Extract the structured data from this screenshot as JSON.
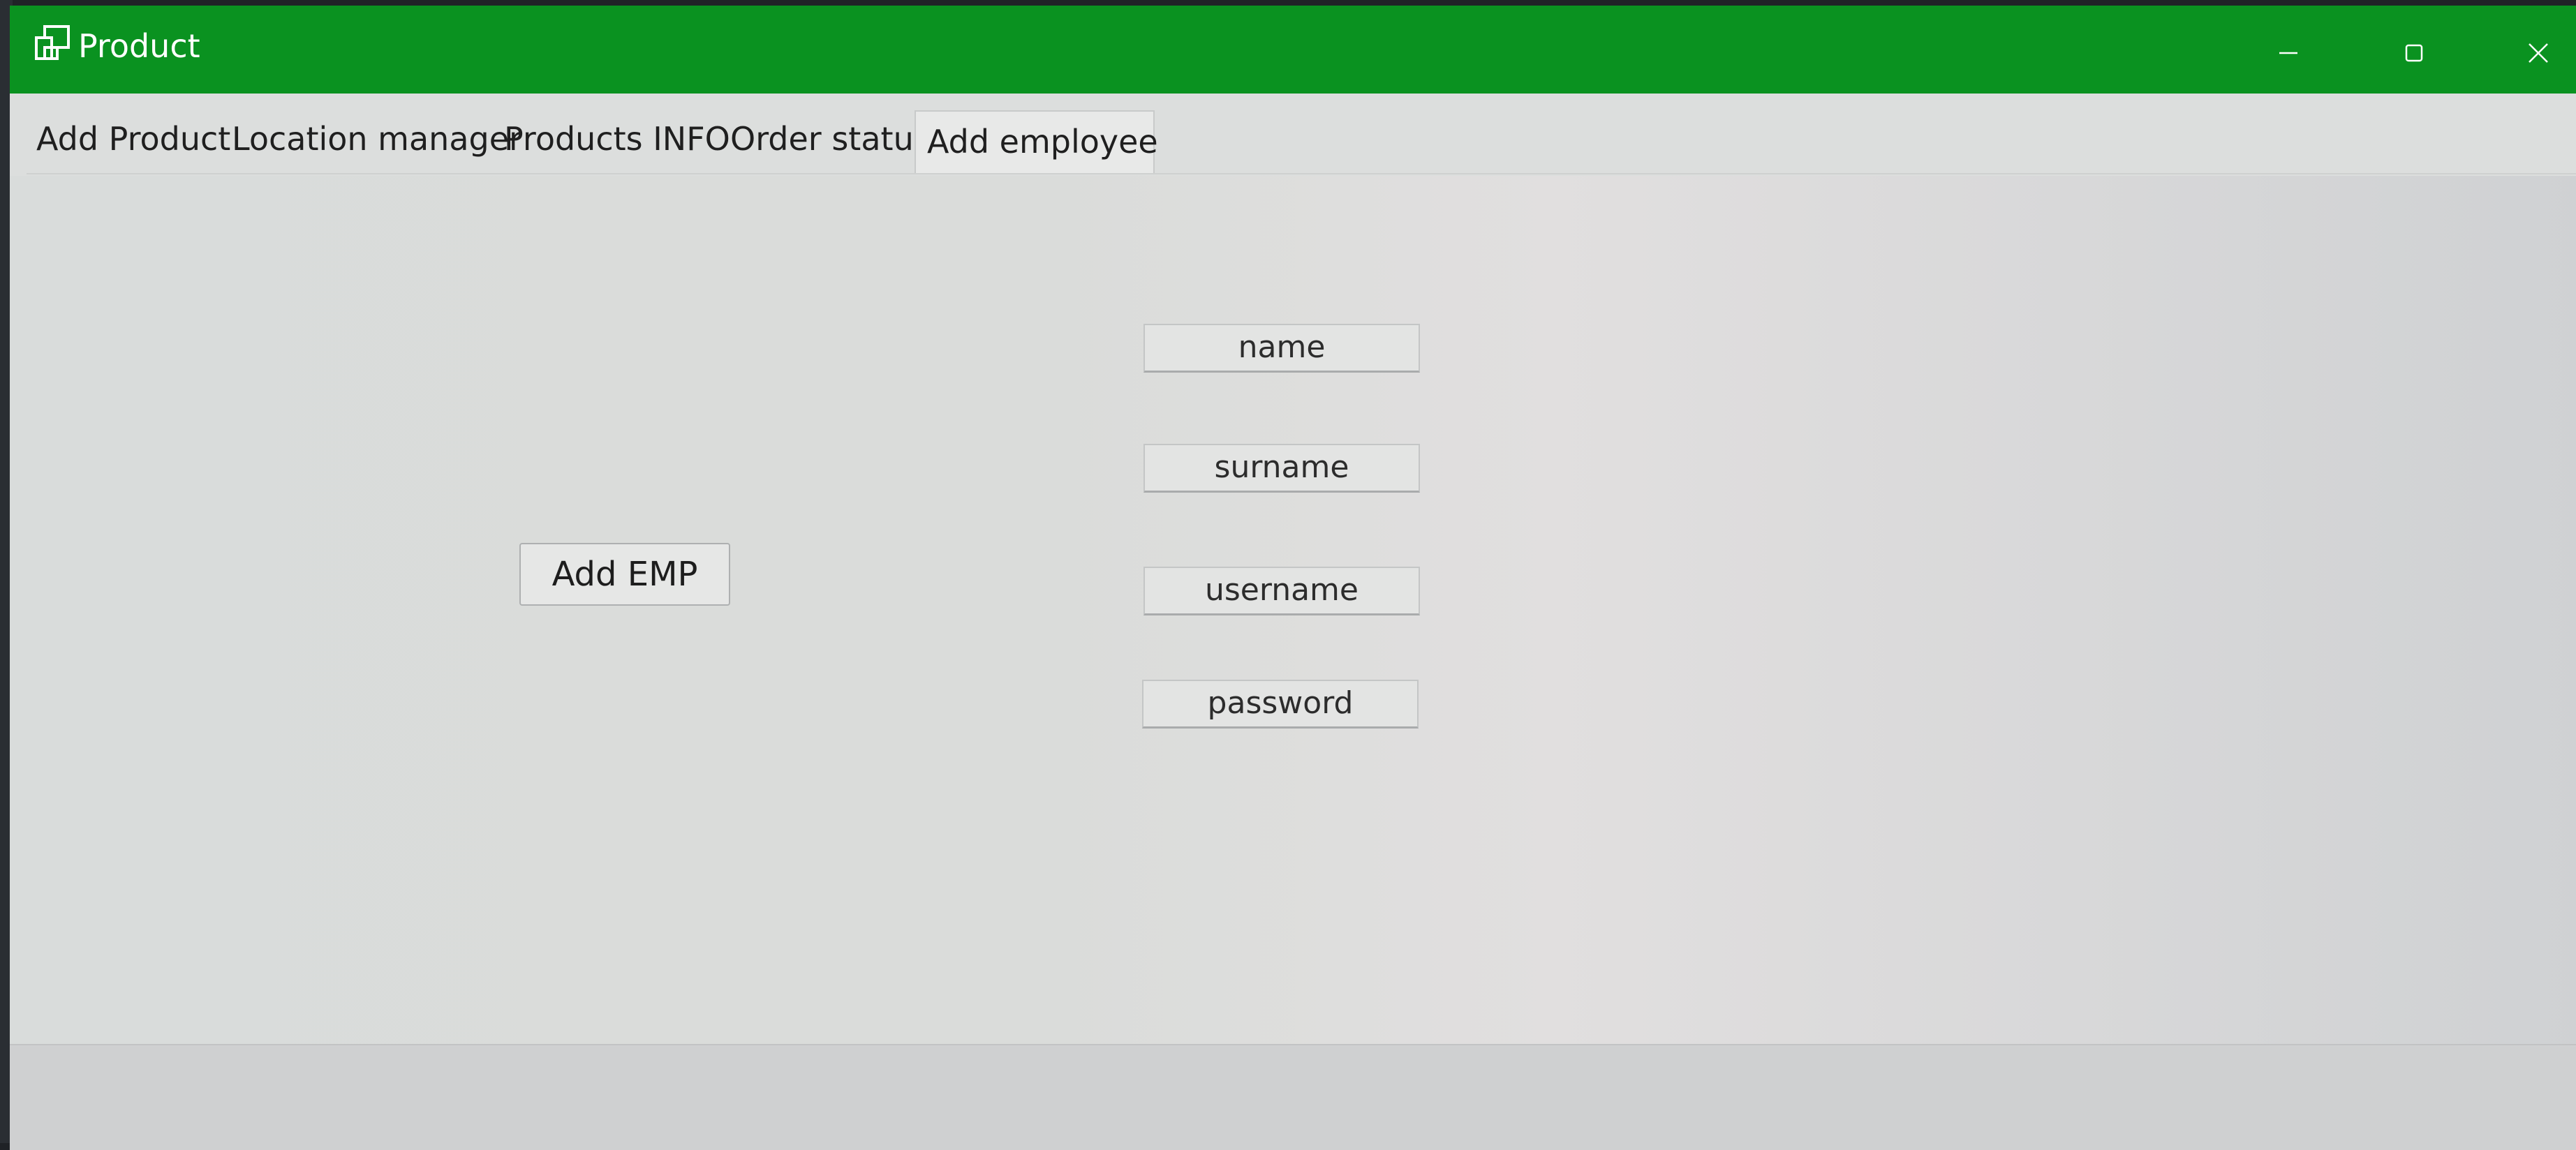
{
  "window": {
    "title": "Product",
    "titlebar_color": "#0a9220",
    "icon": "app-windows-icon",
    "controls": [
      "minimize-icon",
      "maximize-icon",
      "close-icon"
    ]
  },
  "tabs": [
    {
      "label": "Add Product",
      "active": false
    },
    {
      "label": "Location manager",
      "active": false
    },
    {
      "label": "Products INFO",
      "active": false
    },
    {
      "label": "Order status",
      "active": false
    },
    {
      "label": "Add employee",
      "active": true
    }
  ],
  "form": {
    "fields": [
      {
        "placeholder": "name"
      },
      {
        "placeholder": "surname"
      },
      {
        "placeholder": "username"
      },
      {
        "placeholder": "password"
      }
    ],
    "submit_label": "Add EMP"
  }
}
